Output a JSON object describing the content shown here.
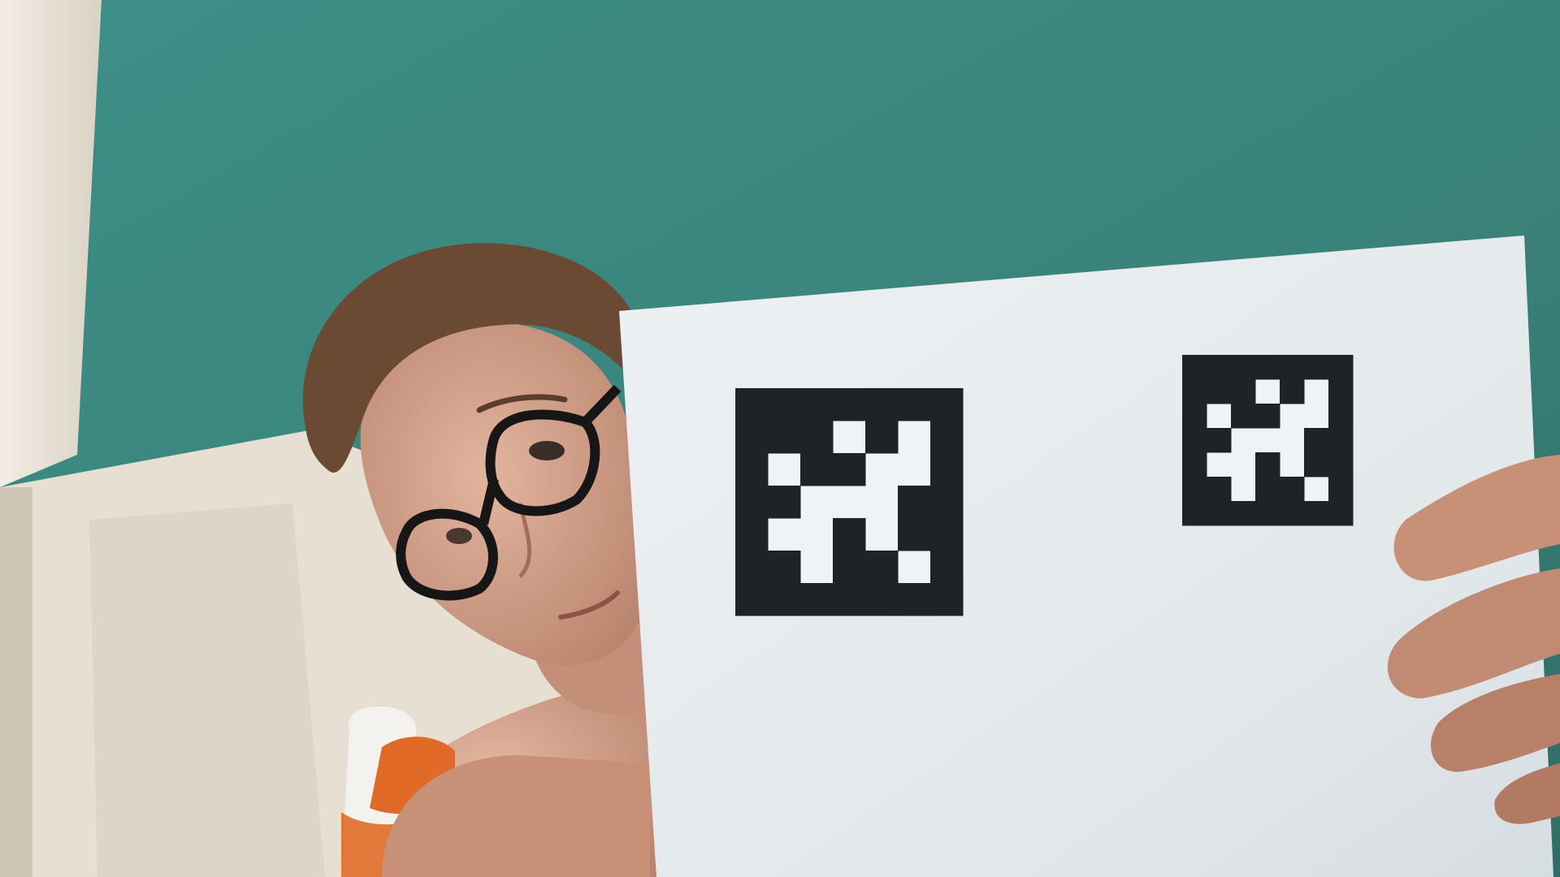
{
  "scene": {
    "description_colors": {
      "wall_teal": "#3f8e85",
      "wall_teal_dark": "#2f6f68",
      "door_frame": "#e9e3d8",
      "door_shadow": "#cfc7b8",
      "paper": "#e8ecef",
      "marker_black": "#1f2328",
      "skin": "#d8a58f",
      "skin_shadow": "#b98069",
      "hair": "#6b4a34",
      "glasses": "#1a1a1a",
      "bottle_white": "#f4f4f2",
      "bottle_orange": "#e06a26"
    },
    "markers": [
      {
        "grid": [
          [
            1,
            1,
            1,
            1,
            1,
            1,
            1
          ],
          [
            1,
            1,
            1,
            0,
            1,
            0,
            1
          ],
          [
            1,
            0,
            1,
            1,
            0,
            0,
            1
          ],
          [
            1,
            1,
            0,
            0,
            0,
            1,
            1
          ],
          [
            1,
            0,
            0,
            1,
            0,
            1,
            1
          ],
          [
            1,
            1,
            0,
            1,
            1,
            0,
            1
          ],
          [
            1,
            1,
            1,
            1,
            1,
            1,
            1
          ]
        ]
      },
      {
        "grid": [
          [
            1,
            1,
            1,
            1,
            1,
            1,
            1
          ],
          [
            1,
            1,
            1,
            0,
            1,
            0,
            1
          ],
          [
            1,
            0,
            1,
            1,
            0,
            0,
            1
          ],
          [
            1,
            1,
            0,
            0,
            0,
            1,
            1
          ],
          [
            1,
            0,
            0,
            1,
            0,
            1,
            1
          ],
          [
            1,
            1,
            0,
            1,
            1,
            0,
            1
          ],
          [
            1,
            1,
            1,
            1,
            1,
            1,
            1
          ]
        ]
      }
    ]
  }
}
